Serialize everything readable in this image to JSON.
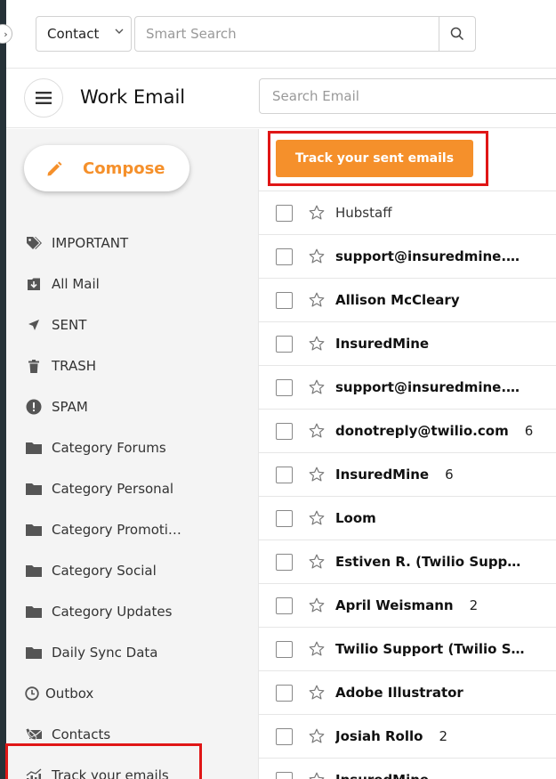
{
  "topbar": {
    "contact_select": "Contact",
    "smart_search_placeholder": "Smart Search"
  },
  "header": {
    "title": "Work Email",
    "search_placeholder": "Search Email"
  },
  "sidebar": {
    "compose_label": "Compose",
    "items": [
      {
        "label": "IMPORTANT",
        "icon": "tags-icon"
      },
      {
        "label": "All Mail",
        "icon": "inbox-download-icon"
      },
      {
        "label": "SENT",
        "icon": "paper-plane-icon"
      },
      {
        "label": "TRASH",
        "icon": "trash-icon"
      },
      {
        "label": "SPAM",
        "icon": "exclamation-circle-icon"
      },
      {
        "label": "Category Forums",
        "icon": "folder-icon"
      },
      {
        "label": "Category Personal",
        "icon": "folder-icon"
      },
      {
        "label": "Category Promoti…",
        "icon": "folder-icon"
      },
      {
        "label": "Category Social",
        "icon": "folder-icon"
      },
      {
        "label": "Category Updates",
        "icon": "folder-icon"
      },
      {
        "label": "Daily Sync Data",
        "icon": "folder-icon"
      },
      {
        "label": "Outbox",
        "icon": "clock-icon"
      },
      {
        "label": "Contacts",
        "icon": "mail-contacts-icon"
      },
      {
        "label": "Track your emails",
        "icon": "chart-icon"
      }
    ]
  },
  "list": {
    "track_button": "Track your sent emails",
    "emails": [
      {
        "sender": "Hubstaff",
        "count": "",
        "read": true
      },
      {
        "sender": "support@insuredmine.co…",
        "count": "",
        "read": false
      },
      {
        "sender": "Allison McCleary",
        "count": "",
        "read": false
      },
      {
        "sender": "InsuredMine",
        "count": "",
        "read": false
      },
      {
        "sender": "support@insuredmine.co…",
        "count": "",
        "read": false
      },
      {
        "sender": "donotreply@twilio.com",
        "count": "6",
        "read": false
      },
      {
        "sender": "InsuredMine",
        "count": "6",
        "read": false
      },
      {
        "sender": "Loom",
        "count": "",
        "read": false
      },
      {
        "sender": "Estiven R. (Twilio Support)",
        "count": "",
        "read": false
      },
      {
        "sender": "April Weismann",
        "count": "2",
        "read": false
      },
      {
        "sender": "Twilio Support (Twilio Sup…",
        "count": "",
        "read": false
      },
      {
        "sender": "Adobe Illustrator",
        "count": "",
        "read": false
      },
      {
        "sender": "Josiah Rollo",
        "count": "2",
        "read": false
      },
      {
        "sender": "InsuredMine",
        "count": "",
        "read": false
      }
    ]
  },
  "colors": {
    "accent": "#f5902b",
    "highlight_border": "#e01616",
    "rail": "#263238"
  }
}
